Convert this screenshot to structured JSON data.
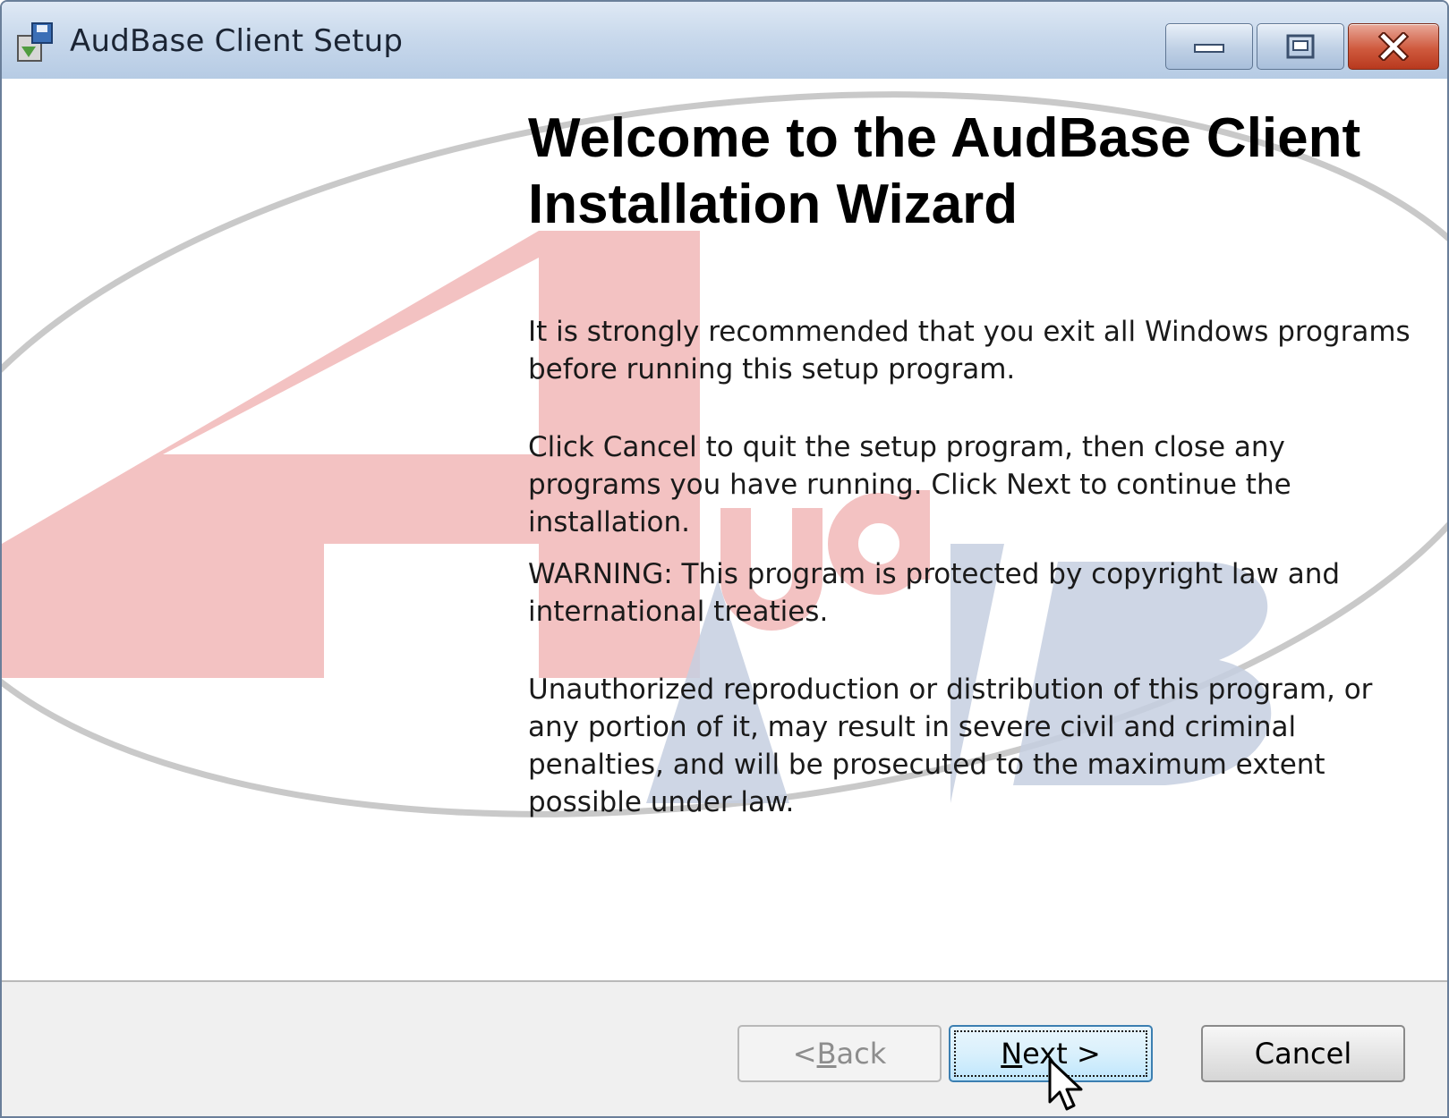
{
  "window": {
    "title": "AudBase Client Setup",
    "controls": [
      "minimize",
      "maximize",
      "close"
    ]
  },
  "content": {
    "heading": "Welcome to the AudBase Client Installation Wizard",
    "paragraphs": [
      "It is strongly recommended that you exit all Windows programs before running this setup program.",
      "Click Cancel to quit the setup program, then close any programs you have running.  Click Next to continue the installation.",
      "WARNING: This program is protected by copyright law and international treaties.",
      "Unauthorized reproduction or distribution of this program, or any portion of it, may result in severe civil and criminal penalties, and will be prosecuted to the maximum extent possible under law."
    ],
    "watermark_logo_text": "AudB",
    "colors": {
      "logo_red": "#f0b8b8",
      "logo_blue": "#b9c4d8",
      "accent_border": "#3c7fb1"
    }
  },
  "buttons": {
    "back": {
      "prefix": "< ",
      "mnemonic": "B",
      "rest": "ack",
      "enabled": false
    },
    "next": {
      "prefix": "",
      "mnemonic": "N",
      "rest": "ext >",
      "enabled": true,
      "focused": true
    },
    "cancel": {
      "label": "Cancel",
      "enabled": true
    }
  }
}
